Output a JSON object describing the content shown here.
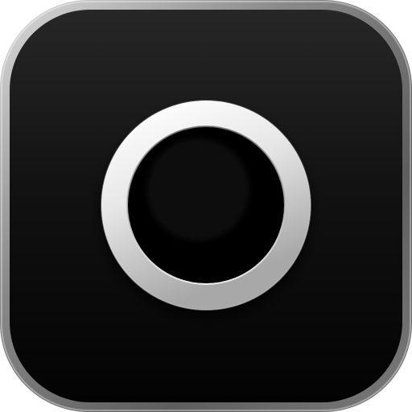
{
  "app_icon": {
    "icon": "ring-icon",
    "colors": {
      "background": "#ffffff",
      "bezel_light": "#f2f2f2",
      "bezel_dark": "#5a5a5a",
      "tile_top": "#262626",
      "tile_bottom": "#000000",
      "ring_light": "#ffffff",
      "ring_dark": "#9a9a9a"
    }
  }
}
